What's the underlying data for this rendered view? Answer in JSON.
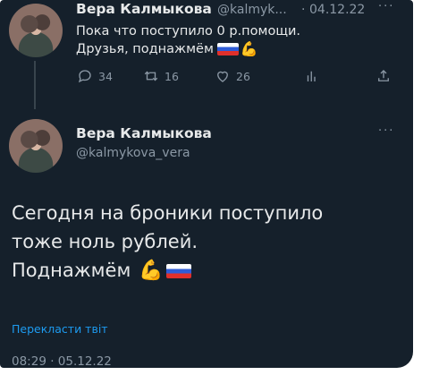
{
  "tweet_reply": {
    "author_name": "Вера Калмыкова",
    "handle_truncated": "@kalmyk...",
    "separator": "·",
    "date": "04.12.22",
    "line1": "Пока что поступило 0 р.помощи.",
    "line2": "Друзья, поднажмём",
    "stats": {
      "replies": "34",
      "retweets": "16",
      "likes": "26"
    }
  },
  "tweet_main": {
    "author_name": "Вера Калмыкова",
    "handle": "@kalmykova_vera",
    "line1": "Сегодня на броники  поступило",
    "line2": "тоже  ноль рублей.",
    "line3": "Поднажмём",
    "translate_label": "Перекласти твіт",
    "timestamp": "08:29 · 05.12.22"
  },
  "more_icon": "···",
  "colors": {
    "background": "#15202b",
    "text": "#e7e9ea",
    "muted": "#8b98a5",
    "link": "#1d9bf0"
  },
  "icons": [
    "reply-icon",
    "retweet-icon",
    "like-icon",
    "stats-icon",
    "share-icon",
    "flexed-biceps-icon",
    "russian-flag-icon"
  ]
}
